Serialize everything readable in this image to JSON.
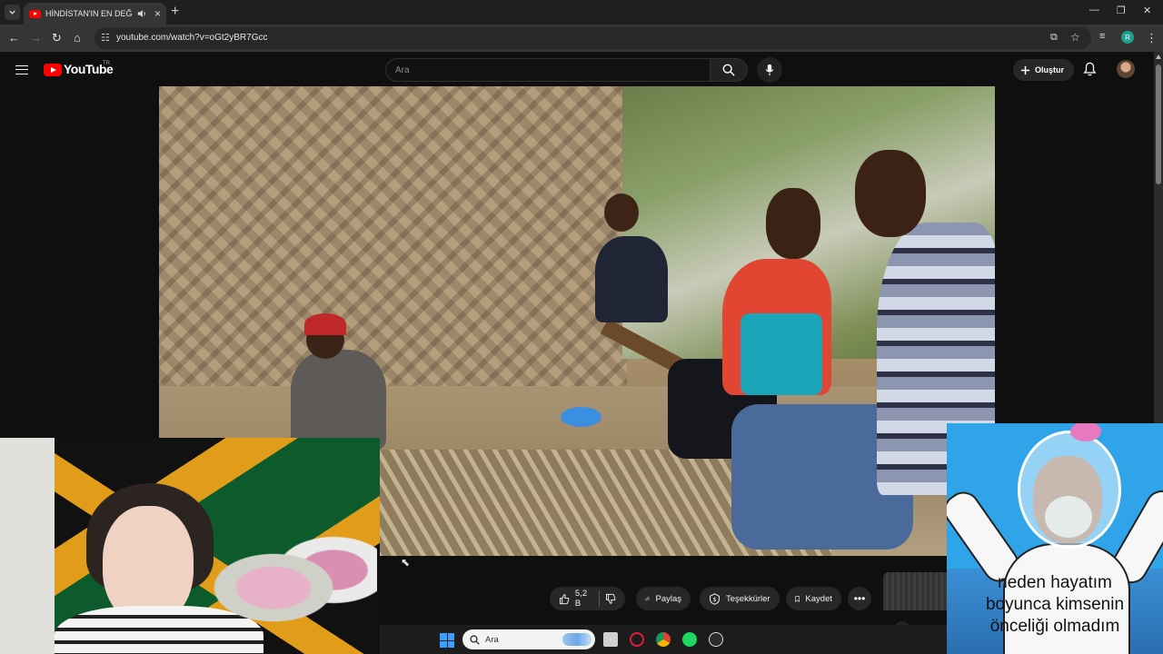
{
  "browser": {
    "tab_title": "HİNDİSTAN'IN EN DEĞERSİZ",
    "url": "youtube.com/watch?v=oGt2yBR7Gcc",
    "profile_initial": "R"
  },
  "youtube": {
    "logo_text": "YouTube",
    "region": "TR",
    "search_placeholder": "Ara",
    "create_label": "Oluştur"
  },
  "video_actions": {
    "like_count": "5,2 B",
    "share_label": "Paylaş",
    "thanks_label": "Teşekkürler",
    "save_label": "Kaydet"
  },
  "overlay": {
    "meme_line1": "neden hayatım",
    "meme_line2": "boyunca kimsenin",
    "meme_line3": "önceliği olmadım"
  },
  "taskbar": {
    "search_placeholder": "Ara"
  },
  "colors": {
    "youtube_red": "#ff0000",
    "page_bg": "#0f0f0f",
    "pill_bg": "#272727"
  }
}
